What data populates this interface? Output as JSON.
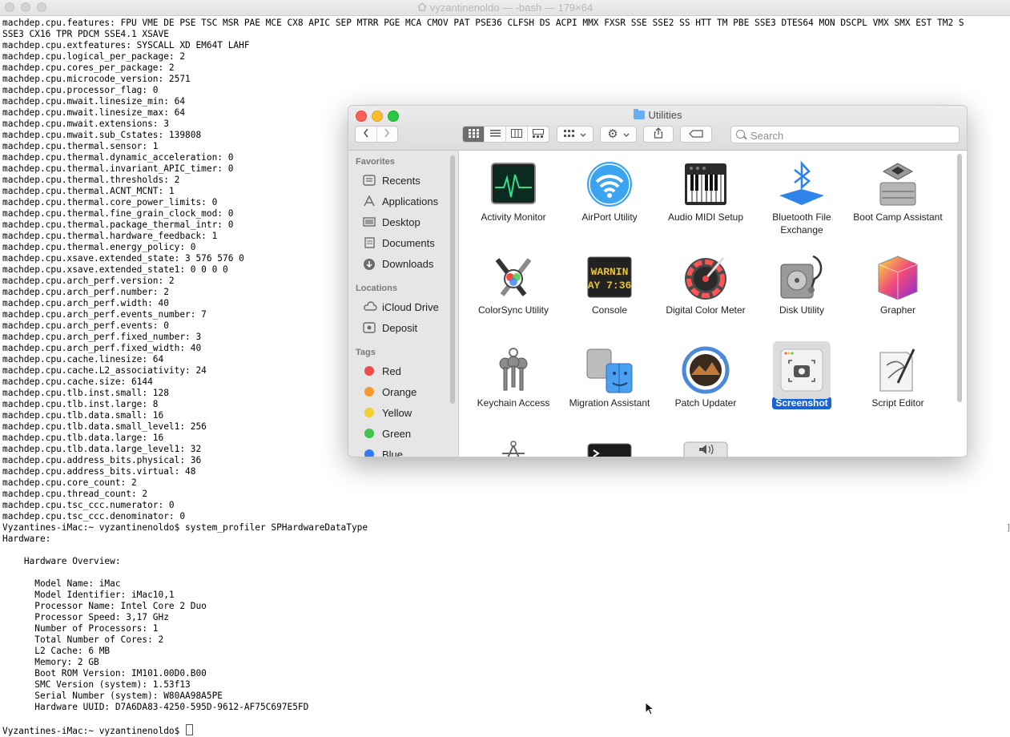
{
  "terminal": {
    "title": "vyzantinenoldo — -bash — 179×64",
    "lines": [
      "machdep.cpu.features: FPU VME DE PSE TSC MSR PAE MCE CX8 APIC SEP MTRR PGE MCA CMOV PAT PSE36 CLFSH DS ACPI MMX FXSR SSE SSE2 SS HTT TM PBE SSE3 DTES64 MON DSCPL VMX SMX EST TM2 S",
      "SSE3 CX16 TPR PDCM SSE4.1 XSAVE",
      "machdep.cpu.extfeatures: SYSCALL XD EM64T LAHF",
      "machdep.cpu.logical_per_package: 2",
      "machdep.cpu.cores_per_package: 2",
      "machdep.cpu.microcode_version: 2571",
      "machdep.cpu.processor_flag: 0",
      "machdep.cpu.mwait.linesize_min: 64",
      "machdep.cpu.mwait.linesize_max: 64",
      "machdep.cpu.mwait.extensions: 3",
      "machdep.cpu.mwait.sub_Cstates: 139808",
      "machdep.cpu.thermal.sensor: 1",
      "machdep.cpu.thermal.dynamic_acceleration: 0",
      "machdep.cpu.thermal.invariant_APIC_timer: 0",
      "machdep.cpu.thermal.thresholds: 2",
      "machdep.cpu.thermal.ACNT_MCNT: 1",
      "machdep.cpu.thermal.core_power_limits: 0",
      "machdep.cpu.thermal.fine_grain_clock_mod: 0",
      "machdep.cpu.thermal.package_thermal_intr: 0",
      "machdep.cpu.thermal.hardware_feedback: 1",
      "machdep.cpu.thermal.energy_policy: 0",
      "machdep.cpu.xsave.extended_state: 3 576 576 0",
      "machdep.cpu.xsave.extended_state1: 0 0 0 0",
      "machdep.cpu.arch_perf.version: 2",
      "machdep.cpu.arch_perf.number: 2",
      "machdep.cpu.arch_perf.width: 40",
      "machdep.cpu.arch_perf.events_number: 7",
      "machdep.cpu.arch_perf.events: 0",
      "machdep.cpu.arch_perf.fixed_number: 3",
      "machdep.cpu.arch_perf.fixed_width: 40",
      "machdep.cpu.cache.linesize: 64",
      "machdep.cpu.cache.L2_associativity: 24",
      "machdep.cpu.cache.size: 6144",
      "machdep.cpu.tlb.inst.small: 128",
      "machdep.cpu.tlb.inst.large: 8",
      "machdep.cpu.tlb.data.small: 16",
      "machdep.cpu.tlb.data.small_level1: 256",
      "machdep.cpu.tlb.data.large: 16",
      "machdep.cpu.tlb.data.large_level1: 32",
      "machdep.cpu.address_bits.physical: 36",
      "machdep.cpu.address_bits.virtual: 48",
      "machdep.cpu.core_count: 2",
      "machdep.cpu.thread_count: 2",
      "machdep.cpu.tsc_ccc.numerator: 0",
      "machdep.cpu.tsc_ccc.denominator: 0",
      "Vyzantines-iMac:~ vyzantinenoldo$ system_profiler SPHardwareDataType",
      "Hardware:",
      "",
      "    Hardware Overview:",
      "",
      "      Model Name: iMac",
      "      Model Identifier: iMac10,1",
      "      Processor Name: Intel Core 2 Duo",
      "      Processor Speed: 3,17 GHz",
      "      Number of Processors: 1",
      "      Total Number of Cores: 2",
      "      L2 Cache: 6 MB",
      "      Memory: 2 GB",
      "      Boot ROM Version: IM101.00D0.B00",
      "      SMC Version (system): 1.53f13",
      "      Serial Number (system): W80AA98A5PE",
      "      Hardware UUID: D7A6DA83-4250-595D-9612-AF75C697E5FD",
      ""
    ],
    "prompt": "Vyzantines-iMac:~ vyzantinenoldo$ "
  },
  "finder": {
    "title": "Utilities",
    "search_placeholder": "Search",
    "sidebar": {
      "favorites_header": "Favorites",
      "favorites": [
        {
          "label": "Recents",
          "icon": "clock-icon"
        },
        {
          "label": "Applications",
          "icon": "applications-icon"
        },
        {
          "label": "Desktop",
          "icon": "desktop-icon"
        },
        {
          "label": "Documents",
          "icon": "document-icon"
        },
        {
          "label": "Downloads",
          "icon": "download-icon"
        }
      ],
      "locations_header": "Locations",
      "locations": [
        {
          "label": "iCloud Drive",
          "icon": "cloud-icon"
        },
        {
          "label": "Deposit",
          "icon": "disk-icon"
        }
      ],
      "tags_header": "Tags",
      "tags": [
        {
          "label": "Red",
          "color": "#f04a4a"
        },
        {
          "label": "Orange",
          "color": "#f59a2a"
        },
        {
          "label": "Yellow",
          "color": "#f5cf2a"
        },
        {
          "label": "Green",
          "color": "#3ec54a"
        },
        {
          "label": "Blue",
          "color": "#2f7cf6"
        }
      ]
    },
    "apps": [
      {
        "label": "Activity Monitor"
      },
      {
        "label": "AirPort Utility"
      },
      {
        "label": "Audio MIDI Setup"
      },
      {
        "label": "Bluetooth File Exchange"
      },
      {
        "label": "Boot Camp Assistant"
      },
      {
        "label": "ColorSync Utility"
      },
      {
        "label": "Console",
        "icon_text_1": "WARNIN",
        "icon_text_2": "AY 7:36"
      },
      {
        "label": "Digital Color Meter"
      },
      {
        "label": "Disk Utility"
      },
      {
        "label": "Grapher"
      },
      {
        "label": "Keychain Access"
      },
      {
        "label": "Migration Assistant"
      },
      {
        "label": "Patch Updater"
      },
      {
        "label": "Screenshot",
        "selected": true
      },
      {
        "label": "Script Editor"
      }
    ],
    "selection_color": "#1a63d6"
  }
}
